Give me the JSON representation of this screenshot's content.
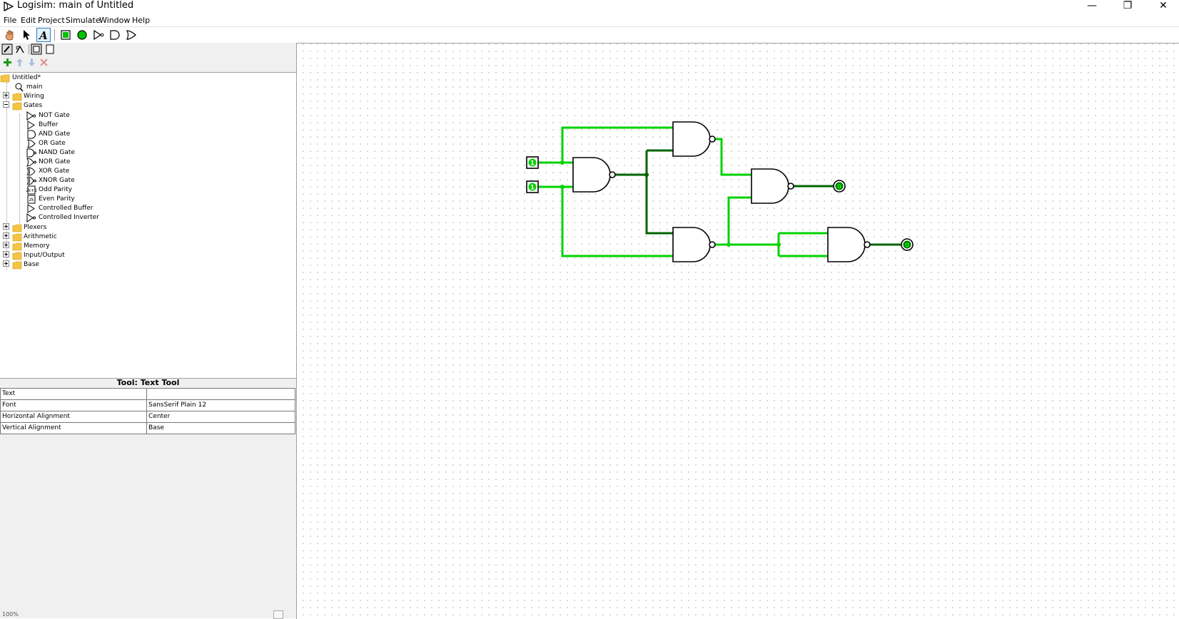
{
  "window": {
    "title": "Logisim: main of Untitled",
    "buttons": {
      "minimize": "—",
      "restore": "❐",
      "close": "✕"
    }
  },
  "menu": [
    "File",
    "Edit",
    "Project",
    "Simulate",
    "Window",
    "Help"
  ],
  "toolbar": {
    "items": [
      "poke-icon",
      "select-icon",
      "text-tool-icon",
      "input-pin-icon",
      "output-pin-icon",
      "not-gate-icon",
      "and-gate-icon",
      "or-gate-icon"
    ],
    "selected": "text-tool-icon"
  },
  "project_toolbar": {
    "row1": [
      "show-tools-icon",
      "show-simulation-icon",
      "edit-layout-icon",
      "edit-appearance-icon"
    ],
    "row2": [
      "add-circuit-icon",
      "move-up-icon",
      "move-down-icon",
      "delete-circuit-icon"
    ]
  },
  "tree": {
    "project": "Untitled*",
    "main": "main",
    "folders": {
      "wiring": "Wiring",
      "gates": "Gates",
      "plexers": "Plexers",
      "arithmetic": "Arithmetic",
      "memory": "Memory",
      "io": "Input/Output",
      "base": "Base"
    },
    "gates": [
      "NOT Gate",
      "Buffer",
      "AND Gate",
      "OR Gate",
      "NAND Gate",
      "NOR Gate",
      "XOR Gate",
      "XNOR Gate",
      "Odd Parity",
      "Even Parity",
      "Controlled Buffer",
      "Controlled Inverter"
    ]
  },
  "attributes": {
    "title": "Tool: Text Tool",
    "rows": [
      {
        "key": "Text",
        "value": ""
      },
      {
        "key": "Font",
        "value": "SansSerif Plain 12"
      },
      {
        "key": "Horizontal Alignment",
        "value": "Center"
      },
      {
        "key": "Vertical Alignment",
        "value": "Base"
      }
    ]
  },
  "status": {
    "zoom": "100%"
  },
  "circuit": {
    "inputs": [
      {
        "value": "1"
      },
      {
        "value": "1"
      }
    ],
    "outputs": [
      {
        "value": "0"
      },
      {
        "value": "0"
      }
    ],
    "colors": {
      "wire_high": "#00d200",
      "wire_low": "#006400",
      "stroke": "#000000"
    }
  }
}
